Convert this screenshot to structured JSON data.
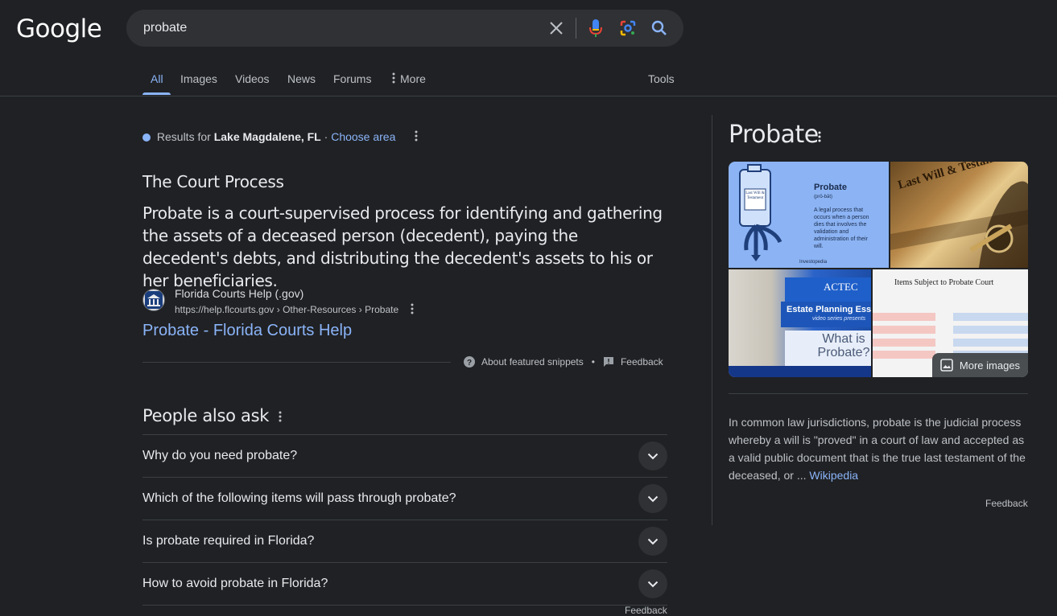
{
  "logo": "Google",
  "search": {
    "query": "probate"
  },
  "tabs": [
    "All",
    "Images",
    "Videos",
    "News",
    "Forums",
    "More"
  ],
  "tools_label": "Tools",
  "location": {
    "prefix": "Results for",
    "place": "Lake Magdalene, FL",
    "sep": "·",
    "choose": "Choose area"
  },
  "snippet": {
    "title": "The Court Process",
    "body": "Probate is a court-supervised process for identifying and gathering the assets of a deceased person (decedent), paying the decedent's debts, and distributing the decedent's assets to his or her beneficiaries.",
    "source_name": "Florida Courts Help (.gov)",
    "source_url": "https://help.flcourts.gov › Other-Resources › Probate",
    "link": "Probate - Florida Courts Help",
    "about": "About featured snippets",
    "dot": "•",
    "feedback": "Feedback"
  },
  "paa": {
    "title": "People also ask",
    "questions": [
      "Why do you need probate?",
      "Which of the following items will pass through probate?",
      "Is probate required in Florida?",
      "How to avoid probate in Florida?"
    ],
    "feedback": "Feedback"
  },
  "knowledge_panel": {
    "title": "Probate",
    "images": {
      "investopedia": {
        "heading": "Probate",
        "pron": "(prō-bāt)",
        "text": "A legal process that occurs when a person dies that involves the validation and administration of their will.",
        "brand": "Investopedia",
        "jug_text": "Last Will & Testament"
      },
      "will": {
        "text": "Last Will & Testament"
      },
      "actec": {
        "brand": "ACTEC",
        "banner": "Estate Planning Esse",
        "sub": "video series presents",
        "question": "What is Probate?"
      },
      "table": {
        "title": "Items Subject to Probate Court"
      }
    },
    "more_images": "More images",
    "description": "In common law jurisdictions, probate is the judicial process whereby a will is \"proved\" in a court of law and accepted as a valid public document that is the true last testament of the deceased, or ...",
    "wiki": "Wikipedia",
    "feedback": "Feedback"
  },
  "colors": {
    "background": "#202124",
    "link": "#8ab4f8",
    "text": "#e8eaed",
    "secondary": "#bdc1c6"
  }
}
